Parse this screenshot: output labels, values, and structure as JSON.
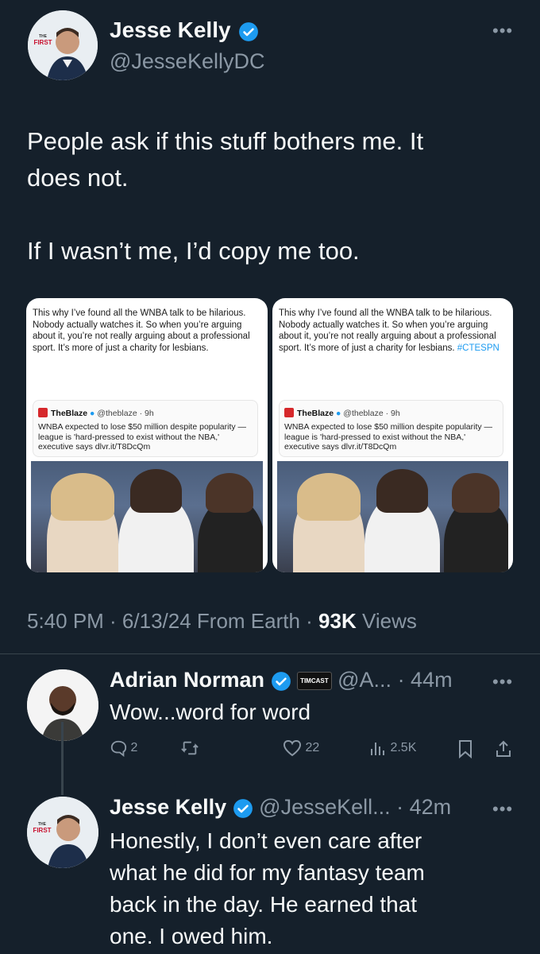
{
  "main_tweet": {
    "author": {
      "name": "Jesse Kelly",
      "handle": "@JesseKellyDC"
    },
    "text_line1": "People ask if this stuff bothers me. It",
    "text_line2": "does not.",
    "text_line3": "If I wasn’t me, I’d copy me too.",
    "timestamp": "5:40 PM · 6/13/24 From Earth · ",
    "views_count": "93K",
    "views_label": " Views"
  },
  "cards": [
    {
      "quote_text": "This why I’ve found all the WNBA talk to be hilarious. Nobody actually watches it. So when you’re arguing about it, you’re not really arguing about a professional sport. It’s more of just a charity for lesbians.",
      "hashtag": "",
      "source_name": "TheBlaze",
      "source_meta": "@theblaze · 9h",
      "headline": "WNBA expected to lose $50 million despite popularity — league is 'hard-pressed to exist without the NBA,' executive says dlvr.it/T8DcQm"
    },
    {
      "quote_text": "This why I’ve found all the WNBA talk to be hilarious. Nobody actually watches it. So when you’re arguing about it, you’re not really arguing about a professional sport. It’s more of just a charity for lesbians.",
      "hashtag": "#CTESPN",
      "source_name": "TheBlaze",
      "source_meta": "@theblaze · 9h",
      "headline": "WNBA expected to lose $50 million despite popularity — league is 'hard-pressed to exist without the NBA,' executive says dlvr.it/T8DcQm"
    }
  ],
  "reply1": {
    "name": "Adrian Norman",
    "badge": "TIMCAST",
    "handle_time": "@A... · 44m",
    "text": "Wow...word for word",
    "actions": {
      "replies": "2",
      "likes": "22",
      "views": "2.5K"
    }
  },
  "reply2": {
    "name": "Jesse Kelly",
    "handle_time": "@JesseKell... · 42m",
    "text_line1": "Honestly, I don’t even care after",
    "text_line2": "what he did for my fantasy team",
    "text_line3": "back in the day. He earned that",
    "text_line4": "one. I owed him."
  },
  "avatar_brand": {
    "top": "THE",
    "main": "FIRST"
  },
  "colors": {
    "background": "#15202b",
    "verified": "#1d9bf0",
    "muted": "#8b98a5",
    "hashtag": "#1d9bf0"
  },
  "icons": [
    "verified-badge-icon",
    "more-options-icon",
    "reply-icon",
    "retweet-icon",
    "like-icon",
    "views-icon",
    "bookmark-icon",
    "share-icon"
  ]
}
